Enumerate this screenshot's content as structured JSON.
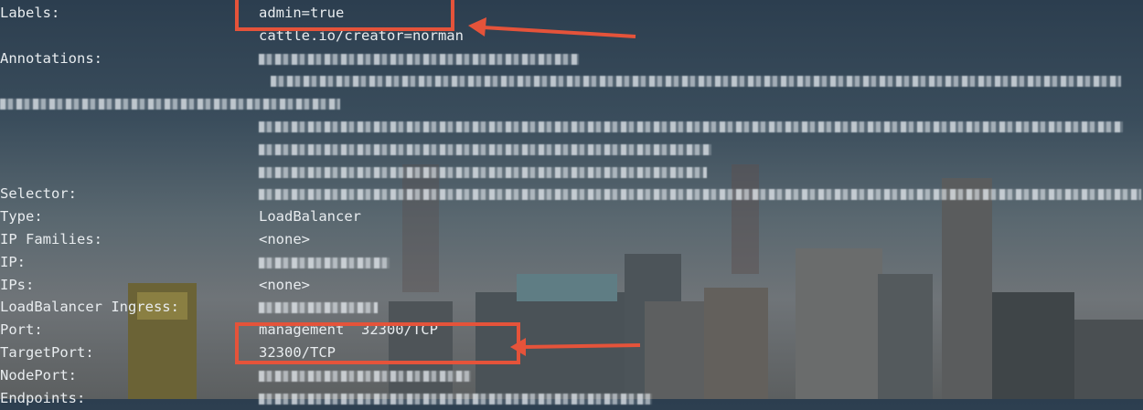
{
  "colors": {
    "annotation": "#e5533a",
    "text": "#e8ecef",
    "background_top": "#2c3e4f",
    "background_bottom": "#5c5f60"
  },
  "rows": [
    {
      "key": "Labels:",
      "value": "admin=true"
    },
    {
      "key": "",
      "value": "cattle.io/creator=norman"
    },
    {
      "key": "Annotations:",
      "value": ""
    },
    {
      "key": "",
      "value": ""
    },
    {
      "key": "",
      "value": ""
    },
    {
      "key": "",
      "value": ""
    },
    {
      "key": "",
      "value": ""
    },
    {
      "key": "",
      "value": ""
    },
    {
      "key": "Selector:",
      "value": ""
    },
    {
      "key": "Type:",
      "value": "LoadBalancer"
    },
    {
      "key": "IP Families:",
      "value": "<none>"
    },
    {
      "key": "IP:",
      "value": ""
    },
    {
      "key": "IPs:",
      "value": "<none>"
    },
    {
      "key": "LoadBalancer Ingress:",
      "value": ""
    },
    {
      "key": "Port:",
      "value": "management  32300/TCP"
    },
    {
      "key": "TargetPort:",
      "value": "32300/TCP"
    },
    {
      "key": "NodePort:",
      "value": ""
    },
    {
      "key": "Endpoints:",
      "value": ""
    }
  ]
}
